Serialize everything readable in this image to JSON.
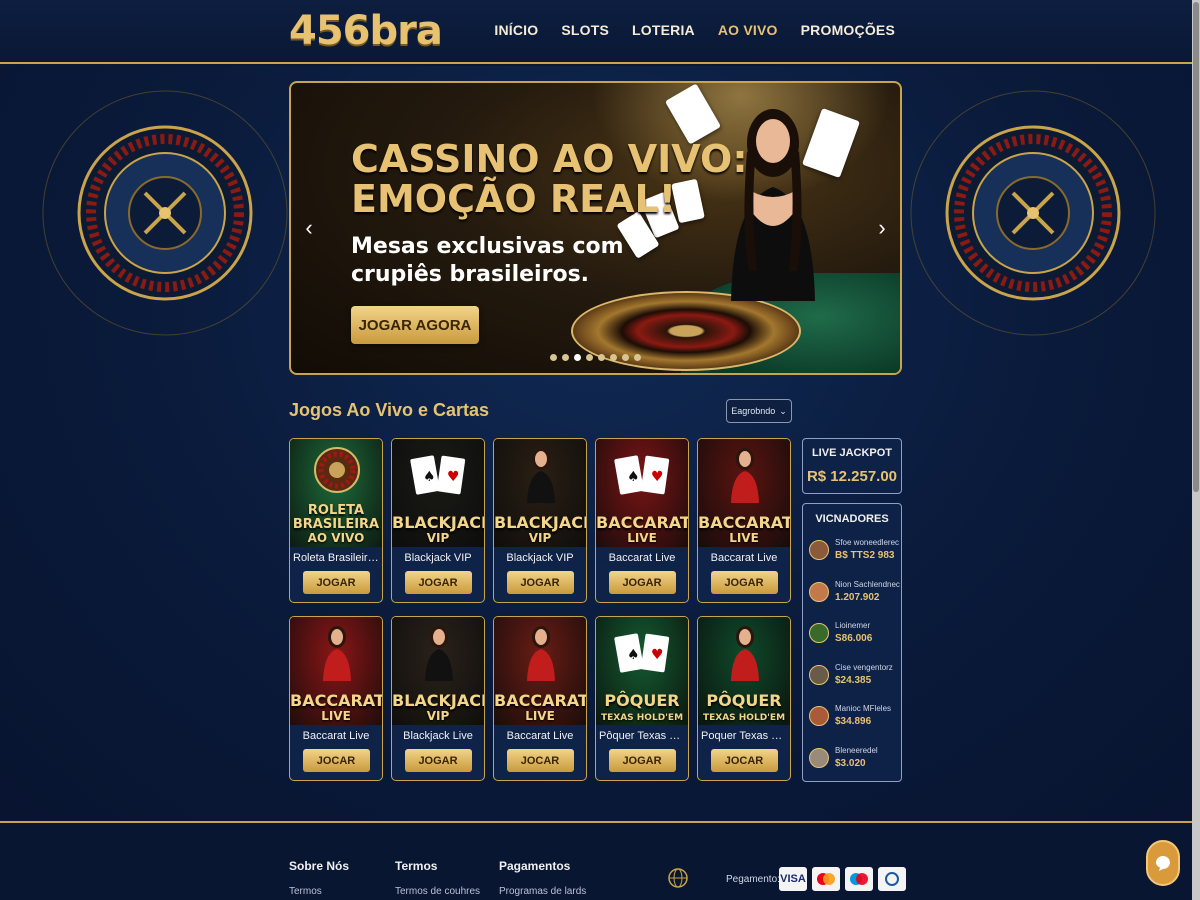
{
  "header": {
    "logo": "456bra",
    "nav": [
      {
        "label": "INÍCIO"
      },
      {
        "label": "SLOTS"
      },
      {
        "label": "LOTERIA"
      },
      {
        "label": "AO VIVO",
        "active": true
      },
      {
        "label": "PROMOÇÕES"
      }
    ]
  },
  "hero": {
    "title_line1": "CASSINO AO VIVO:",
    "title_line2": "EMOÇÃO REAL!",
    "subtitle_line1": "Mesas exclusivas com",
    "subtitle_line2": "crupiês brasileiros.",
    "cta": "JOGAR AGORA",
    "prev_icon": "‹",
    "next_icon": "›",
    "slide_count": 8,
    "active_slide": 2
  },
  "section": {
    "title": "Jogos Ao Vivo e Cartas",
    "sort_label": "Eagrobndo"
  },
  "games": [
    {
      "t1": "ROLETA",
      "t1b": "BRASILEIRA",
      "t2": "AO VIVO",
      "name": "Roleta Brasileira Ao ...",
      "button": "JOGAR",
      "bg": "#1d6b3a",
      "kind": "roulette"
    },
    {
      "t1": "BLACKJACK",
      "t2": "VIP",
      "name": "Blackjack VIP",
      "button": "JOGAR",
      "bg": "#1a1a16",
      "kind": "cards"
    },
    {
      "t1": "BLACKJACK",
      "t2": "VIP",
      "name": "Blackjack VIP",
      "button": "JOGAR",
      "bg": "#2a1f14",
      "kind": "dealer"
    },
    {
      "t1": "BACCARAT",
      "t2": "LIVE",
      "name": "Baccarat Live",
      "button": "JOGAR",
      "bg": "#7a1414",
      "kind": "cards"
    },
    {
      "t1": "BACCARAT",
      "t2": "LIVE",
      "name": "Baccarat Live",
      "button": "JOGAR",
      "bg": "#5a1410",
      "kind": "dealer"
    },
    {
      "t1": "BACCARAT",
      "t2": "LIVE",
      "name": "Baccarat Live",
      "button": "JOCAR",
      "bg": "#8a1616",
      "kind": "dealer"
    },
    {
      "t1": "BLACKJACK",
      "t2": "VIP",
      "name": "Blackjack Live",
      "button": "JOGAR",
      "bg": "#2a221a",
      "kind": "dealer"
    },
    {
      "t1": "BACCARAT",
      "t2": "LIVE",
      "name": "Baccarat Live",
      "button": "JOCAR",
      "bg": "#6a1c14",
      "kind": "dealer"
    },
    {
      "t1": "PÔQUER",
      "t2": "TEXAS HOLD'EM",
      "name": "Pôquer Texas Hold'em",
      "button": "JOGAR",
      "bg": "#145a30",
      "kind": "cards"
    },
    {
      "t1": "PÔQUER",
      "t2": "TEXAS HOLD'EM",
      "name": "Poquer Texas Hold'em",
      "button": "JOCAR",
      "bg": "#0f4a2a",
      "kind": "dealer"
    }
  ],
  "jackpot": {
    "label": "LIVE JACKPOT",
    "value": "R$ 12.257.00"
  },
  "winners": {
    "title": "VICNADORES",
    "items": [
      {
        "name": "Sfoe woneedlerec",
        "amount": "B$ TTS2 983"
      },
      {
        "name": "Nion Sachlendnec",
        "amount": "1.207.902"
      },
      {
        "name": "Lioinemer",
        "amount": "S86.006"
      },
      {
        "name": "Cise vengentorz",
        "amount": "$24.385"
      },
      {
        "name": "Manioc MFleles",
        "amount": "$34.896"
      },
      {
        "name": "Bleneeredel",
        "amount": "$3.020"
      }
    ]
  },
  "footer": {
    "columns": [
      {
        "title": "Sobre Nós",
        "link": "Termos"
      },
      {
        "title": "Termos",
        "link": "Termos de couhres"
      },
      {
        "title": "Pagamentos",
        "link": "Programas de lards"
      }
    ],
    "payment_label": "Pegamento:",
    "payment_icons": [
      "VISA",
      "mastercard",
      "maestro",
      "diners"
    ]
  },
  "colors": {
    "gold": "#e6c271",
    "navy": "#0a1834",
    "border_gold": "#c9a44a"
  }
}
